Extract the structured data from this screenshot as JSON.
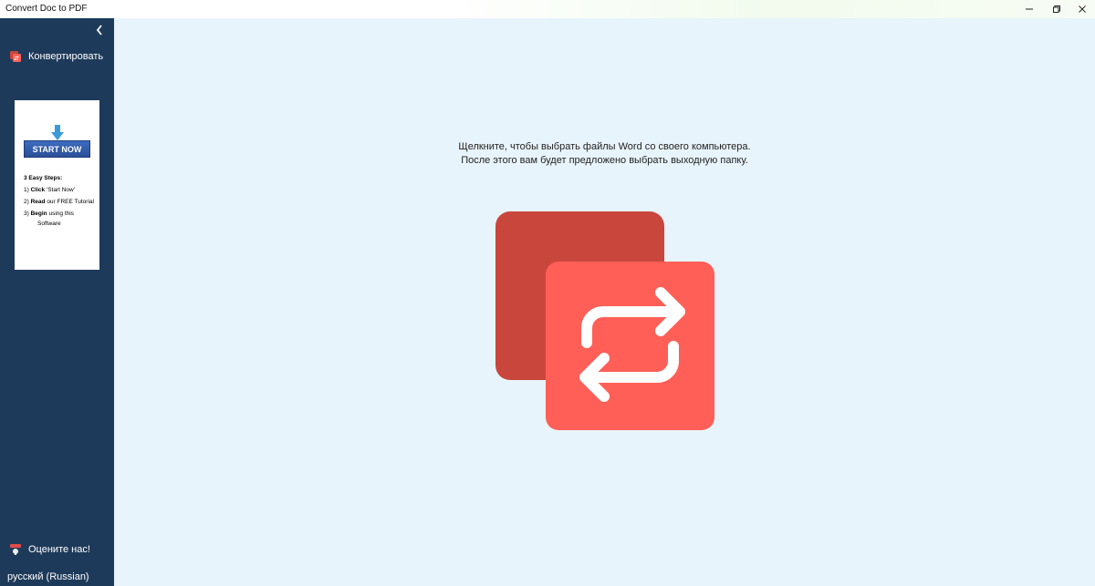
{
  "window": {
    "title": "Convert Doc to PDF",
    "controls": [
      "minimize",
      "restore",
      "close"
    ]
  },
  "sidebar": {
    "collapse_icon": "chevron-left-icon",
    "convert": {
      "label": "Конвертировать",
      "icon": "convert-icon"
    },
    "promo": {
      "button": "START NOW",
      "steps_title": "3 Easy Steps:",
      "step1_num": "1)",
      "step1_bold": "Click",
      "step1_rest": "'Start Now'",
      "step2_num": "2)",
      "step2_bold": "Read",
      "step2_rest": "our FREE Tutorial",
      "step3_num": "3)",
      "step3_bold": "Begin",
      "step3_rest": "using this",
      "step3_cont": "Software"
    },
    "rate": {
      "label": "Оцените нас!",
      "icon": "rate-icon"
    },
    "language": "русский (Russian)"
  },
  "main": {
    "instruction_line1": "Щелкните, чтобы выбрать файлы Word со своего компьютера.",
    "instruction_line2": "После этого вам будет предложено выбрать выходную папку.",
    "hero_icon": "convert-arrows-icon"
  },
  "colors": {
    "sidebar": "#1e3a5a",
    "background": "#e8f4fb",
    "back_tile": "#c9463d",
    "front_tile": "#ff5f57"
  }
}
